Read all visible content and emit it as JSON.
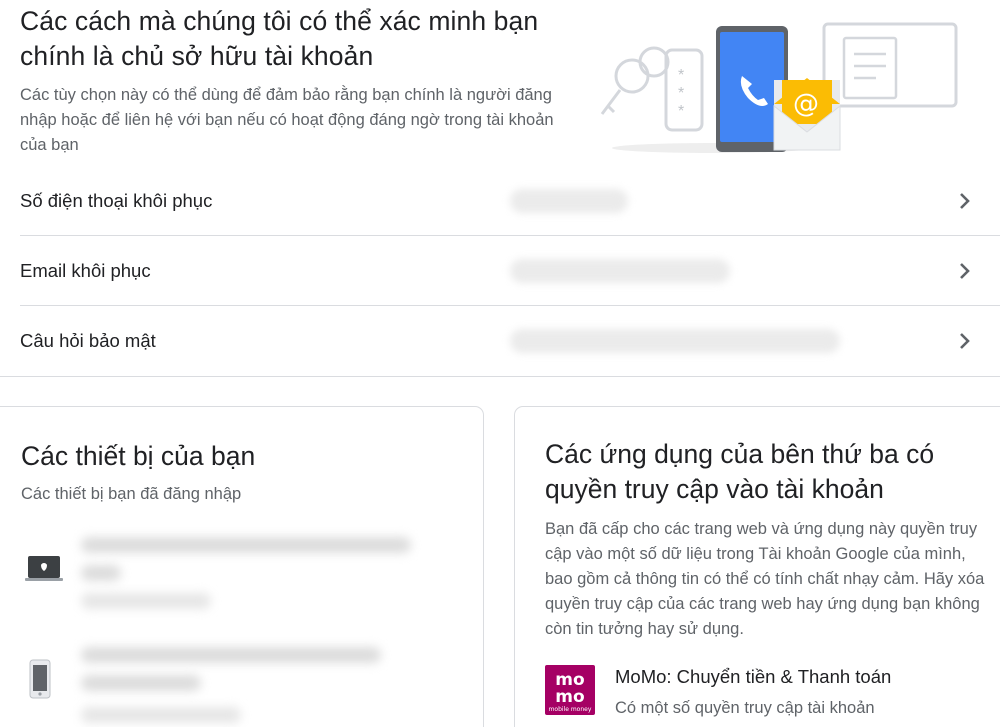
{
  "header": {
    "title": "Các cách mà chúng tôi có thể xác minh bạn chính là chủ sở hữu tài khoản",
    "subtitle": "Các tùy chọn này có thể dùng để đảm bảo rằng bạn chính là người đăng nhập hoặc để liên hệ với bạn nếu có hoạt động đáng ngờ trong tài khoản của bạn"
  },
  "recovery_rows": [
    {
      "label": "Số điện thoại khôi phục",
      "icon": "chevron-right-icon"
    },
    {
      "label": "Email khôi phục",
      "icon": "chevron-right-icon"
    },
    {
      "label": "Câu hỏi bảo mật",
      "icon": "chevron-right-icon"
    }
  ],
  "devices": {
    "title": "Các thiết bị của bạn",
    "subtitle": "Các thiết bị bạn đã đăng nhập",
    "items": [
      {
        "icon": "laptop-icon"
      },
      {
        "icon": "phone-icon"
      }
    ]
  },
  "third_party": {
    "title": "Các ứng dụng của bên thứ ba có quyền truy cập vào tài khoản",
    "description": "Bạn đã cấp cho các trang web và ứng dụng này quyền truy cập vào một số dữ liệu trong Tài khoản Google của mình, bao gồm cả thông tin có thể có tính chất nhạy cảm. Hãy xóa quyền truy cập của các trang web hay ứng dụng bạn không còn tin tưởng hay sử dụng.",
    "apps": [
      {
        "name": "MoMo: Chuyển tiền & Thanh toán",
        "access": "Có một số quyền truy cập tài khoản",
        "logo_top": "mo",
        "logo_bottom": "mo",
        "logo_caption": "mobile money",
        "logo_color": "#a50064"
      }
    ]
  },
  "colors": {
    "primary_text": "#202124",
    "secondary_text": "#5f6368",
    "divider": "#dadce0",
    "accent_blue": "#4285f4",
    "accent_yellow": "#fbbc04"
  }
}
